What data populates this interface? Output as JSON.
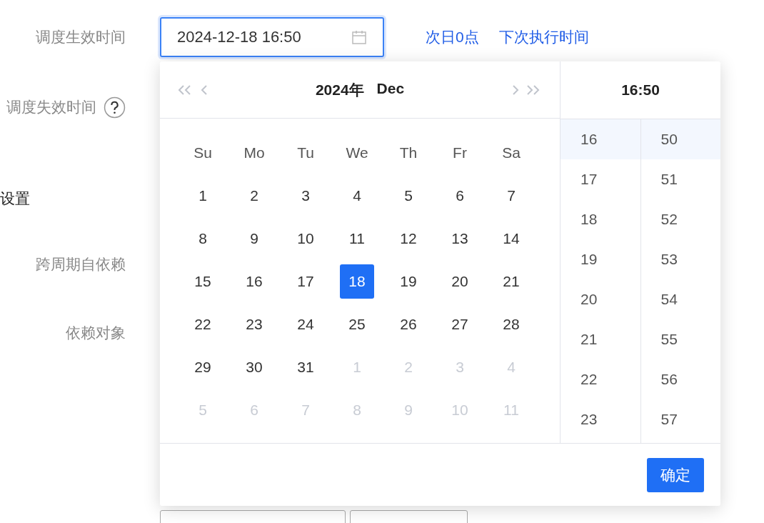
{
  "form": [
    {
      "label": "调度生效时间",
      "kind": "label"
    },
    {
      "label": "调度失效时间",
      "kind": "helplabel"
    },
    {
      "label": "设置",
      "kind": "section"
    },
    {
      "label": "跨周期自依赖",
      "kind": "label"
    },
    {
      "label": "依赖对象",
      "kind": "label"
    }
  ],
  "date_input": {
    "value": "2024-12-18 16:50",
    "focused": true
  },
  "links": [
    "次日0点",
    "下次执行时间"
  ],
  "picker": {
    "year": "2024年",
    "month": "Dec",
    "time": "16:50",
    "weekdays": [
      "Su",
      "Mo",
      "Tu",
      "We",
      "Th",
      "Fr",
      "Sa"
    ],
    "days": [
      {
        "text": "1",
        "outside": false,
        "selected": false
      },
      {
        "text": "2",
        "outside": false,
        "selected": false
      },
      {
        "text": "3",
        "outside": false,
        "selected": false
      },
      {
        "text": "4",
        "outside": false,
        "selected": false
      },
      {
        "text": "5",
        "outside": false,
        "selected": false
      },
      {
        "text": "6",
        "outside": false,
        "selected": false
      },
      {
        "text": "7",
        "outside": false,
        "selected": false
      },
      {
        "text": "8",
        "outside": false,
        "selected": false
      },
      {
        "text": "9",
        "outside": false,
        "selected": false
      },
      {
        "text": "10",
        "outside": false,
        "selected": false
      },
      {
        "text": "11",
        "outside": false,
        "selected": false
      },
      {
        "text": "12",
        "outside": false,
        "selected": false
      },
      {
        "text": "13",
        "outside": false,
        "selected": false
      },
      {
        "text": "14",
        "outside": false,
        "selected": false
      },
      {
        "text": "15",
        "outside": false,
        "selected": false
      },
      {
        "text": "16",
        "outside": false,
        "selected": false
      },
      {
        "text": "17",
        "outside": false,
        "selected": false
      },
      {
        "text": "18",
        "outside": false,
        "selected": true
      },
      {
        "text": "19",
        "outside": false,
        "selected": false
      },
      {
        "text": "20",
        "outside": false,
        "selected": false
      },
      {
        "text": "21",
        "outside": false,
        "selected": false
      },
      {
        "text": "22",
        "outside": false,
        "selected": false
      },
      {
        "text": "23",
        "outside": false,
        "selected": false
      },
      {
        "text": "24",
        "outside": false,
        "selected": false
      },
      {
        "text": "25",
        "outside": false,
        "selected": false
      },
      {
        "text": "26",
        "outside": false,
        "selected": false
      },
      {
        "text": "27",
        "outside": false,
        "selected": false
      },
      {
        "text": "28",
        "outside": false,
        "selected": false
      },
      {
        "text": "29",
        "outside": false,
        "selected": false
      },
      {
        "text": "30",
        "outside": false,
        "selected": false
      },
      {
        "text": "31",
        "outside": false,
        "selected": false
      },
      {
        "text": "1",
        "outside": true,
        "selected": false
      },
      {
        "text": "2",
        "outside": true,
        "selected": false
      },
      {
        "text": "3",
        "outside": true,
        "selected": false
      },
      {
        "text": "4",
        "outside": true,
        "selected": false
      },
      {
        "text": "5",
        "outside": true,
        "selected": false
      },
      {
        "text": "6",
        "outside": true,
        "selected": false
      },
      {
        "text": "7",
        "outside": true,
        "selected": false
      },
      {
        "text": "8",
        "outside": true,
        "selected": false
      },
      {
        "text": "9",
        "outside": true,
        "selected": false
      },
      {
        "text": "10",
        "outside": true,
        "selected": false
      },
      {
        "text": "11",
        "outside": true,
        "selected": false
      }
    ],
    "hours": [
      {
        "text": "16",
        "selected": true
      },
      {
        "text": "17",
        "selected": false
      },
      {
        "text": "18",
        "selected": false
      },
      {
        "text": "19",
        "selected": false
      },
      {
        "text": "20",
        "selected": false
      },
      {
        "text": "21",
        "selected": false
      },
      {
        "text": "22",
        "selected": false
      },
      {
        "text": "23",
        "selected": false
      }
    ],
    "minutes": [
      {
        "text": "50",
        "selected": true
      },
      {
        "text": "51",
        "selected": false
      },
      {
        "text": "52",
        "selected": false
      },
      {
        "text": "53",
        "selected": false
      },
      {
        "text": "54",
        "selected": false
      },
      {
        "text": "55",
        "selected": false
      },
      {
        "text": "56",
        "selected": false
      },
      {
        "text": "57",
        "selected": false
      }
    ],
    "ok_button": "确定"
  }
}
